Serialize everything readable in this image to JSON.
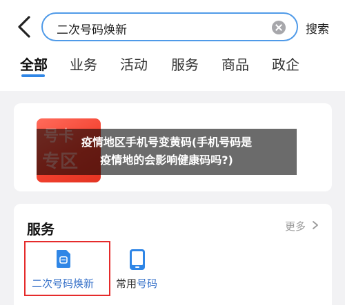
{
  "header": {
    "search_text": "二次号码焕新",
    "search_button": "搜索"
  },
  "tabs": [
    {
      "label": "全部",
      "active": true
    },
    {
      "label": "业务"
    },
    {
      "label": "活动"
    },
    {
      "label": "服务"
    },
    {
      "label": "商品"
    },
    {
      "label": "政企"
    }
  ],
  "result": {
    "thumb_line1": "号卡",
    "thumb_line2": "专区",
    "overlay_line1": "疫情地区手机号变黄码(手机号码是",
    "overlay_line2": "疫情地的会影响健康码吗?)"
  },
  "services": {
    "title": "服务",
    "more_label": "更多",
    "items": [
      {
        "label": "二次号码焕新",
        "icon": "document-icon"
      },
      {
        "label_part1": "常用",
        "label_part2": "号码",
        "icon": "phone-icon"
      }
    ]
  },
  "colors": {
    "accent": "#2f86e6",
    "search_border": "#4f9ae8",
    "highlight_box": "#e52b2b",
    "link_text": "#3570c8"
  }
}
